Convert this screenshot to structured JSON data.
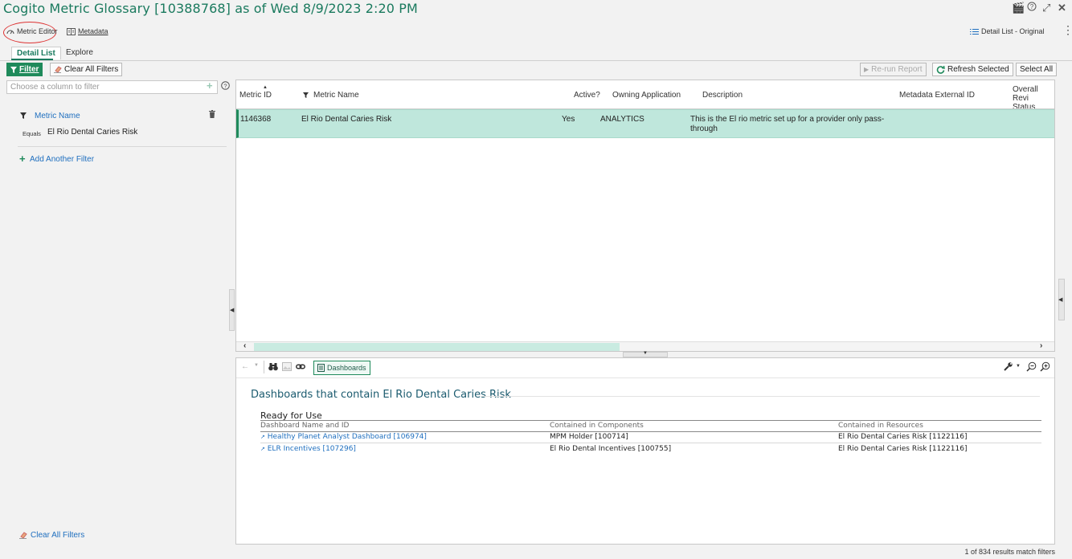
{
  "window": {
    "title": "Cogito Metric Glossary [10388768] as of Wed 8/9/2023  2:20 PM",
    "controls": [
      "🎬",
      "?",
      "⤢",
      "✕"
    ]
  },
  "toolbar": {
    "metric_editor": "Metric Editor",
    "metadata": "Metadata",
    "detail_list_original": "Detail List - Original"
  },
  "tabs": [
    "Detail List",
    "Explore"
  ],
  "filter_bar": {
    "filter": "Filter",
    "clear_all_filters": "Clear All Filters",
    "rerun_report": "Re-run Report",
    "refresh_selected": "Refresh Selected",
    "select_all": "Select All"
  },
  "left_panel": {
    "column_filter_placeholder": "Choose a column to filter",
    "filter_field": "Metric Name",
    "filter_op": "Equals",
    "filter_value": "El Rio Dental Caries Risk",
    "add_another_filter": "Add Another Filter",
    "clear_all_filters_bottom": "Clear All Filters"
  },
  "grid": {
    "columns": [
      "Metric ID",
      "Metric Name",
      "Active?",
      "Owning Application",
      "Description",
      "Metadata External ID",
      "Overall Revi",
      "Status"
    ],
    "row": {
      "metric_id": "1146368",
      "metric_name": "El Rio Dental Caries Risk",
      "active": "Yes",
      "owning_app": "ANALYTICS",
      "description_1": "This is the El rio metric set up for a provider only pass-",
      "description_2": "through"
    }
  },
  "dashboards_pane": {
    "tab_label": "Dashboards",
    "heading": "Dashboards that contain El Rio Dental Caries Risk",
    "section": "Ready for Use",
    "columns": [
      "Dashboard Name and ID",
      "Contained in Components",
      "Contained in Resources"
    ],
    "rows": [
      {
        "name": "Healthy Planet Analyst Dashboard [106974]",
        "component": "MPM Holder [100714]",
        "resource": "El Rio Dental Caries Risk [1122116]"
      },
      {
        "name": "ELR Incentives [107296]",
        "component": "El Rio Dental Incentives [100755]",
        "resource": "El Rio Dental Caries Risk [1122116]"
      }
    ]
  },
  "footer": {
    "count_text": "1 of 834 results match filters"
  },
  "colors": {
    "brand_green": "#1a7a5e",
    "selected_row": "#bfe7dc",
    "link_blue": "#1f6fbf",
    "annotation_red": "#dd3333"
  }
}
